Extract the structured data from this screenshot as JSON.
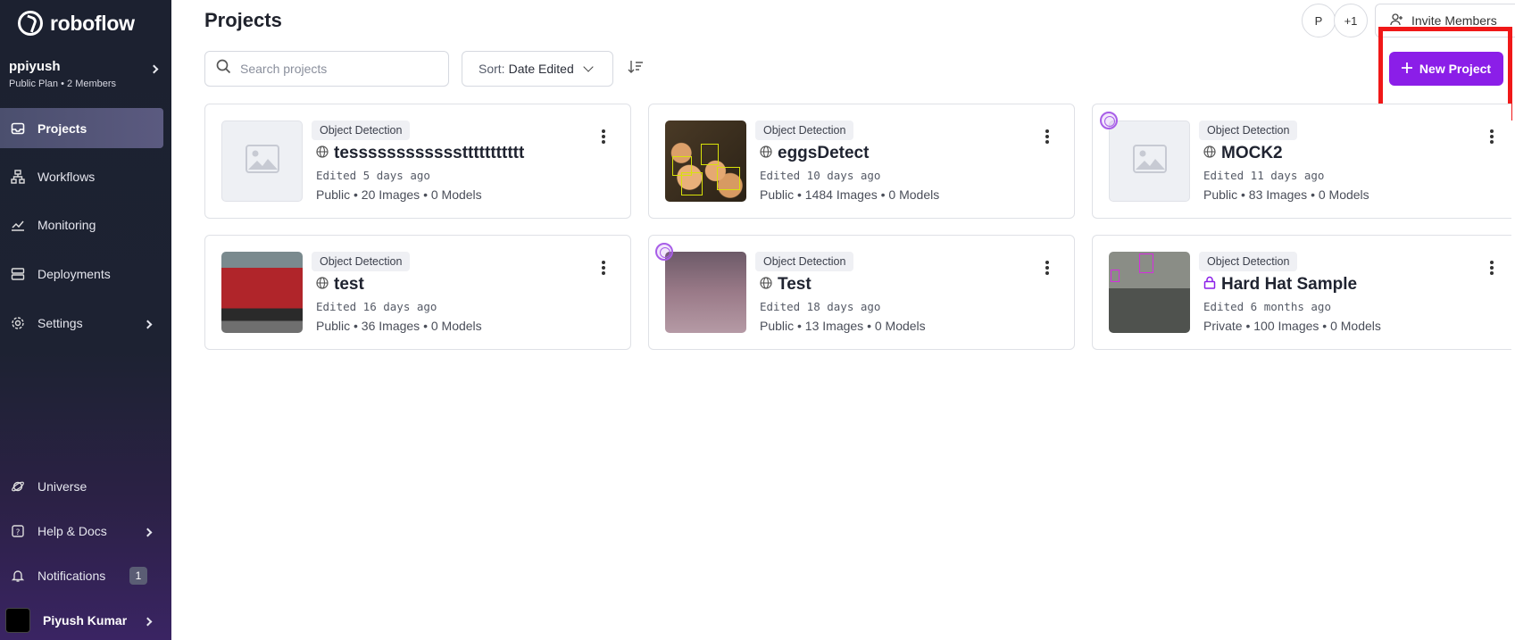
{
  "brand": {
    "name": "roboflow"
  },
  "workspace": {
    "name": "ppiyush",
    "plan": "Public Plan",
    "members": "2 Members"
  },
  "nav": {
    "projects": "Projects",
    "workflows": "Workflows",
    "monitoring": "Monitoring",
    "deployments": "Deployments",
    "settings": "Settings",
    "universe": "Universe",
    "help": "Help & Docs",
    "notifications": "Notifications",
    "notifications_count": "1",
    "user": "Piyush Kumar"
  },
  "header": {
    "title": "Projects",
    "avatar_initial": "P",
    "avatar_more": "+1",
    "invite_label": "Invite Members"
  },
  "toolbar": {
    "search_placeholder": "Search projects",
    "sort_prefix": "Sort:",
    "sort_value": "Date Edited",
    "new_project_label": "New Project"
  },
  "colors": {
    "accent": "#8b1ee8",
    "highlight": "#f01818",
    "sidebar": "#1c2130"
  },
  "projects": [
    {
      "type": "Object Detection",
      "name": "tessssssssssssttttttttttt",
      "visibility_icon": "globe-icon",
      "edited": "Edited 5 days ago",
      "meta": "Public • 20 Images • 0 Models"
    },
    {
      "type": "Object Detection",
      "name": "eggsDetect",
      "visibility_icon": "globe-icon",
      "edited": "Edited 10 days ago",
      "meta": "Public • 1484 Images • 0 Models"
    },
    {
      "type": "Object Detection",
      "name": "MOCK2",
      "visibility_icon": "globe-icon",
      "edited": "Edited 11 days ago",
      "meta": "Public • 83 Images • 0 Models"
    },
    {
      "type": "Object Detection",
      "name": "test",
      "visibility_icon": "globe-icon",
      "edited": "Edited 16 days ago",
      "meta": "Public • 36 Images • 0 Models"
    },
    {
      "type": "Object Detection",
      "name": "Test",
      "visibility_icon": "globe-icon",
      "edited": "Edited 18 days ago",
      "meta": "Public • 13 Images • 0 Models"
    },
    {
      "type": "Object Detection",
      "name": "Hard Hat Sample",
      "visibility_icon": "lock-icon",
      "edited": "Edited 6 months ago",
      "meta": "Private • 100 Images • 0 Models"
    }
  ]
}
